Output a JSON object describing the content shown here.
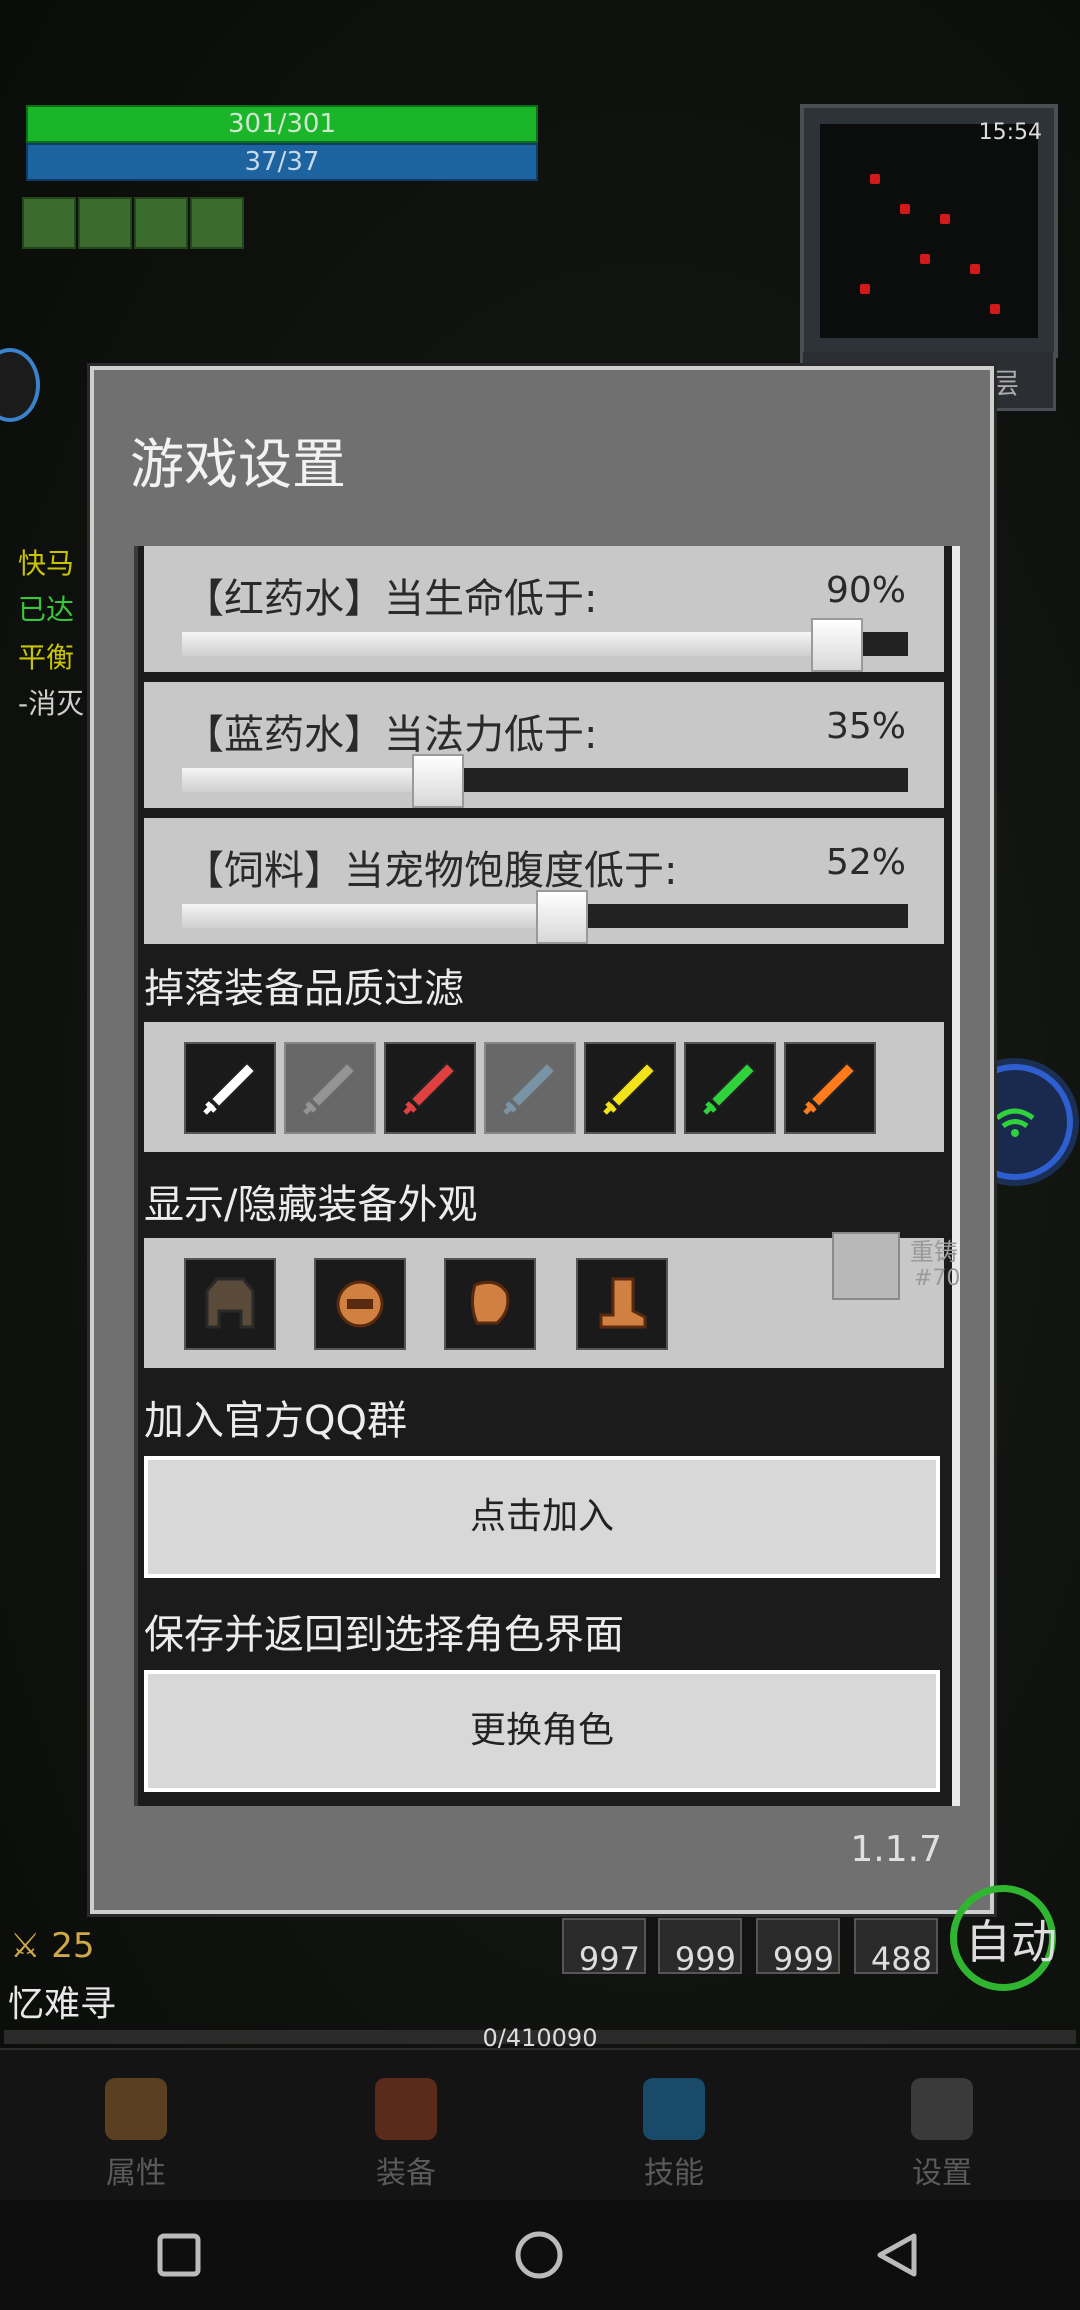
{
  "hud": {
    "hp": "301/301",
    "mp": "37/37",
    "minimap_time": "15:54",
    "floor_label": "层",
    "side_texts": [
      "快马",
      "已达",
      "平衡",
      "-消灭"
    ],
    "level": "25",
    "player_name": "忆难寻",
    "auto_label": "自动",
    "exp_text": "0/410090",
    "quick_slots": [
      "997",
      "999",
      "999",
      "488"
    ],
    "loot_hint": "重铸",
    "loot_hint_sub": "#70"
  },
  "dialog": {
    "title": "游戏设置",
    "sliders": [
      {
        "label": "【红药水】当生命低于:",
        "value": "90%",
        "fraction": 0.9
      },
      {
        "label": "【蓝药水】当法力低于:",
        "value": "35%",
        "fraction": 0.35
      },
      {
        "label": "【饲料】当宠物饱腹度低于:",
        "value": "52%",
        "fraction": 0.52
      }
    ],
    "drop_filter_title": "掉落装备品质过滤",
    "drop_filter_icons": [
      {
        "name": "white-quality-sword-icon",
        "color": "#ffffff",
        "enabled": true
      },
      {
        "name": "gray-quality-sword-icon",
        "color": "#6a6a6a",
        "enabled": false
      },
      {
        "name": "red-gem-sword-icon",
        "color": "#e04040",
        "enabled": true
      },
      {
        "name": "blue-quality-sword-icon",
        "color": "#3a6a8a",
        "enabled": false
      },
      {
        "name": "yellow-quality-sword-icon",
        "color": "#f2e21a",
        "enabled": true
      },
      {
        "name": "green-quality-sword-icon",
        "color": "#2fd23a",
        "enabled": true
      },
      {
        "name": "orange-quality-sword-icon",
        "color": "#ff7a1a",
        "enabled": true
      }
    ],
    "appearance_title": "显示/隐藏装备外观",
    "appearance_icons": [
      "helmet-icon",
      "face-mask-icon",
      "glove-icon",
      "boot-icon"
    ],
    "qq_title": "加入官方QQ群",
    "qq_button": "点击加入",
    "save_title": "保存并返回到选择角色界面",
    "save_button": "更换角色",
    "version": "1.1.7"
  },
  "bottom_nav": [
    {
      "label": "属性",
      "icon": "helmet-icon",
      "color": "#7a5a2a"
    },
    {
      "label": "装备",
      "icon": "bag-icon",
      "color": "#8a3a2a"
    },
    {
      "label": "技能",
      "icon": "skill-gem-icon",
      "color": "#2a6a8a"
    },
    {
      "label": "设置",
      "icon": "gear-icon",
      "color": "#6a6a6a"
    }
  ],
  "colors": {
    "hp": "#1bb52a",
    "mp": "#1d63a0",
    "dialog_bg": "#707070",
    "panel_bg": "#c8c8c8"
  }
}
